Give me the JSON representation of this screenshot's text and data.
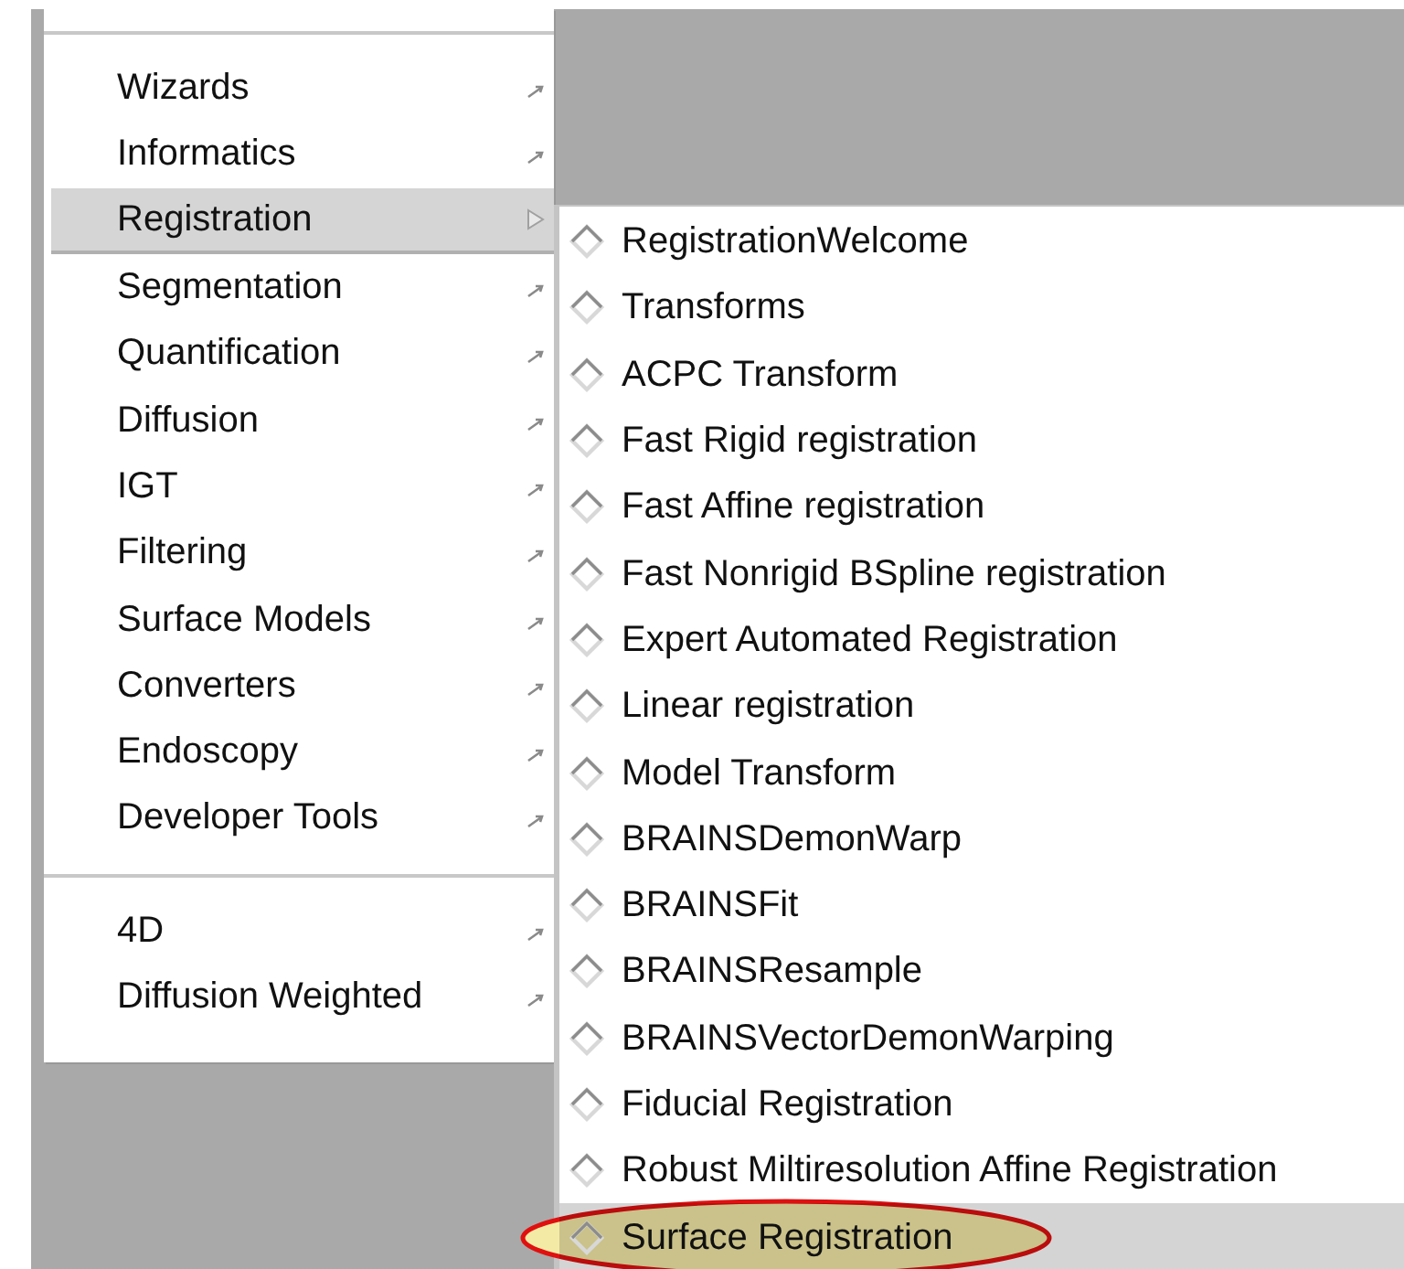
{
  "menu": {
    "groups": [
      {
        "items": [
          {
            "label": "Wizards",
            "selected": false
          },
          {
            "label": "Informatics",
            "selected": false
          },
          {
            "label": "Registration",
            "selected": true
          },
          {
            "label": "Segmentation",
            "selected": false
          },
          {
            "label": "Quantification",
            "selected": false
          },
          {
            "label": "Diffusion",
            "selected": false
          },
          {
            "label": "IGT",
            "selected": false
          },
          {
            "label": "Filtering",
            "selected": false
          },
          {
            "label": "Surface Models",
            "selected": false
          },
          {
            "label": "Converters",
            "selected": false
          },
          {
            "label": "Endoscopy",
            "selected": false
          },
          {
            "label": "Developer Tools",
            "selected": false
          }
        ]
      },
      {
        "items": [
          {
            "label": "4D",
            "selected": false
          },
          {
            "label": "Diffusion Weighted",
            "selected": false
          }
        ]
      }
    ]
  },
  "submenu": {
    "items": [
      {
        "label": "RegistrationWelcome",
        "selected": false,
        "circled": false
      },
      {
        "label": "Transforms",
        "selected": false,
        "circled": false
      },
      {
        "label": "ACPC Transform",
        "selected": false,
        "circled": false
      },
      {
        "label": "Fast Rigid registration",
        "selected": false,
        "circled": false
      },
      {
        "label": "Fast Affine registration",
        "selected": false,
        "circled": false
      },
      {
        "label": "Fast Nonrigid BSpline registration",
        "selected": false,
        "circled": false
      },
      {
        "label": "Expert Automated Registration",
        "selected": false,
        "circled": false
      },
      {
        "label": "Linear registration",
        "selected": false,
        "circled": false
      },
      {
        "label": "Model Transform",
        "selected": false,
        "circled": false
      },
      {
        "label": "BRAINSDemonWarp",
        "selected": false,
        "circled": false
      },
      {
        "label": "BRAINSFit",
        "selected": false,
        "circled": false
      },
      {
        "label": "BRAINSResample",
        "selected": false,
        "circled": false
      },
      {
        "label": "BRAINSVectorDemonWarping",
        "selected": false,
        "circled": false
      },
      {
        "label": "Fiducial Registration",
        "selected": false,
        "circled": false
      },
      {
        "label": "Robust Miltiresolution Affine Registration",
        "selected": false,
        "circled": false
      },
      {
        "label": "Surface Registration",
        "selected": true,
        "circled": true
      }
    ]
  }
}
